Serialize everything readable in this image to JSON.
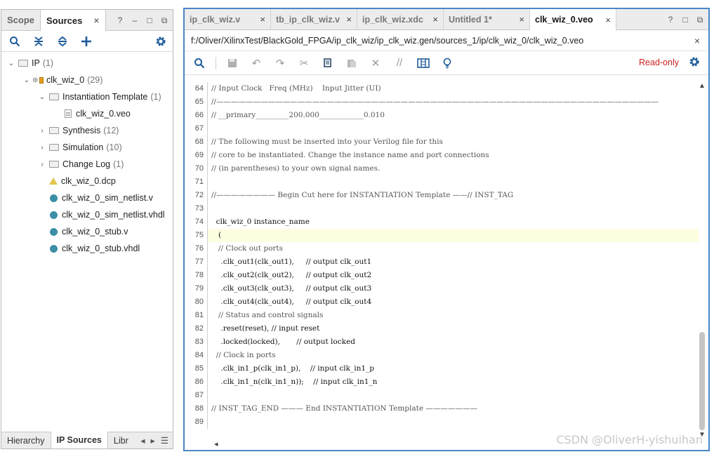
{
  "left_panel": {
    "tabs": [
      {
        "label": "Scope"
      },
      {
        "label": "Sources"
      }
    ],
    "close_glyph": "×",
    "window_buttons": [
      "?",
      "–",
      "□",
      "⧉"
    ],
    "tree": [
      {
        "label": "IP",
        "count": "(1)"
      },
      {
        "label": "clk_wiz_0",
        "count": "(29)"
      },
      {
        "label": "Instantiation Template",
        "count": "(1)"
      },
      {
        "label": "clk_wiz_0.veo",
        "count": ""
      },
      {
        "label": "Synthesis",
        "count": "(12)"
      },
      {
        "label": "Simulation",
        "count": "(10)"
      },
      {
        "label": "Change Log",
        "count": "(1)"
      },
      {
        "label": "clk_wiz_0.dcp",
        "count": ""
      },
      {
        "label": "clk_wiz_0_sim_netlist.v",
        "count": ""
      },
      {
        "label": "clk_wiz_0_sim_netlist.vhdl",
        "count": ""
      },
      {
        "label": "clk_wiz_0_stub.v",
        "count": ""
      },
      {
        "label": "clk_wiz_0_stub.vhdl",
        "count": ""
      }
    ],
    "bottom_tabs": [
      "Hierarchy",
      "IP Sources",
      "Libr"
    ]
  },
  "editor": {
    "tabs": [
      {
        "label": "ip_clk_wiz.v"
      },
      {
        "label": "tb_ip_clk_wiz.v"
      },
      {
        "label": "ip_clk_wiz.xdc"
      },
      {
        "label": "Untitled 1*"
      },
      {
        "label": "clk_wiz_0.veo"
      }
    ],
    "file_path": "f:/Oliver/XilinxTest/BlackGold_FPGA/ip_clk_wiz/ip_clk_wiz.gen/sources_1/ip/clk_wiz_0/clk_wiz_0.veo",
    "read_only_label": "Read-only",
    "code_lines": [
      {
        "n": "64",
        "text": "// Input Clock   Freq (MHz)    Input Jitter (UI)"
      },
      {
        "n": "65",
        "text": "//————————————————————————————————————————————————————————————"
      },
      {
        "n": "66",
        "text": "// __primary_________200.000____________0.010"
      },
      {
        "n": "67",
        "text": ""
      },
      {
        "n": "68",
        "text": "// The following must be inserted into your Verilog file for this"
      },
      {
        "n": "69",
        "text": "// core to be instantiated. Change the instance name and port connections"
      },
      {
        "n": "70",
        "text": "// (in parentheses) to your own signal names."
      },
      {
        "n": "71",
        "text": ""
      },
      {
        "n": "72",
        "text": "//———————— Begin Cut here for INSTANTIATION Template ——// INST_TAG"
      },
      {
        "n": "73",
        "text": ""
      },
      {
        "n": "74",
        "text": "  clk_wiz_0 instance_name"
      },
      {
        "n": "75",
        "text": "   ("
      },
      {
        "n": "76",
        "text": "   // Clock out ports"
      },
      {
        "n": "77",
        "text": "    .clk_out1(clk_out1),     // output clk_out1"
      },
      {
        "n": "78",
        "text": "    .clk_out2(clk_out2),     // output clk_out2"
      },
      {
        "n": "79",
        "text": "    .clk_out3(clk_out3),     // output clk_out3"
      },
      {
        "n": "80",
        "text": "    .clk_out4(clk_out4),     // output clk_out4"
      },
      {
        "n": "81",
        "text": "   // Status and control signals"
      },
      {
        "n": "82",
        "text": "    .reset(reset), // input reset"
      },
      {
        "n": "83",
        "text": "    .locked(locked),       // output locked"
      },
      {
        "n": "84",
        "text": "  // Clock in ports"
      },
      {
        "n": "85",
        "text": "    .clk_in1_p(clk_in1_p),    // input clk_in1_p"
      },
      {
        "n": "86",
        "text": "    .clk_in1_n(clk_in1_n));    // input clk_in1_n"
      },
      {
        "n": "87",
        "text": ""
      },
      {
        "n": "88",
        "text": "// INST_TAG_END ——— End INSTANTIATION Template ———————"
      },
      {
        "n": "89",
        "text": ""
      }
    ]
  },
  "watermark": "CSDN @OliverH-yishuihan"
}
